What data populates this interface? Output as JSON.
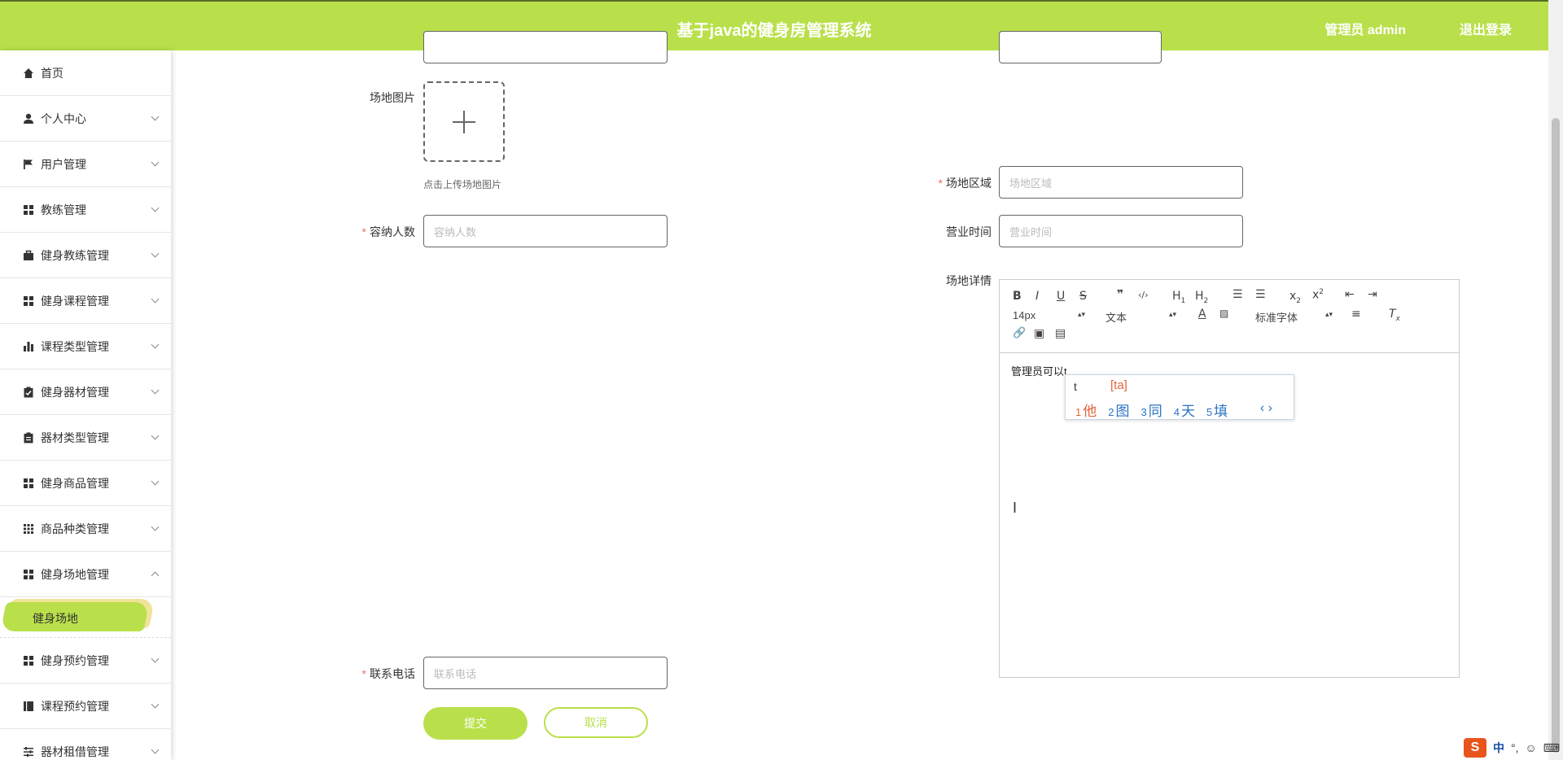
{
  "header": {
    "title": "基于java的健身房管理系统",
    "admin_label": "管理员 admin",
    "logout_label": "退出登录"
  },
  "sidebar": {
    "items": [
      {
        "label": "首页",
        "icon": "home-icon",
        "expandable": false
      },
      {
        "label": "个人中心",
        "icon": "user-icon",
        "expandable": true
      },
      {
        "label": "用户管理",
        "icon": "flag-icon",
        "expandable": true
      },
      {
        "label": "教练管理",
        "icon": "grid-icon",
        "expandable": true
      },
      {
        "label": "健身教练管理",
        "icon": "briefcase-icon",
        "expandable": true
      },
      {
        "label": "健身课程管理",
        "icon": "grid-icon",
        "expandable": true
      },
      {
        "label": "课程类型管理",
        "icon": "bar-chart-icon",
        "expandable": true
      },
      {
        "label": "健身器材管理",
        "icon": "clipboard-check-icon",
        "expandable": true
      },
      {
        "label": "器材类型管理",
        "icon": "clipboard-icon",
        "expandable": true
      },
      {
        "label": "健身商品管理",
        "icon": "grid-icon",
        "expandable": true
      },
      {
        "label": "商品种类管理",
        "icon": "grid-3x3-icon",
        "expandable": true
      },
      {
        "label": "健身场地管理",
        "icon": "grid-icon",
        "expandable": true,
        "expanded": true
      },
      {
        "label": "健身预约管理",
        "icon": "grid-icon",
        "expandable": true
      },
      {
        "label": "课程预约管理",
        "icon": "book-icon",
        "expandable": true
      },
      {
        "label": "器材租借管理",
        "icon": "sliders-icon",
        "expandable": true
      }
    ],
    "active_sub": "健身场地"
  },
  "form": {
    "image_label": "场地图片",
    "upload_tip": "点击上传场地图片",
    "area_label": "场地区域",
    "area_placeholder": "场地区域",
    "capacity_label": "容纳人数",
    "capacity_placeholder": "容纳人数",
    "hours_label": "营业时间",
    "hours_placeholder": "营业时间",
    "detail_label": "场地详情",
    "phone_label": "联系电话",
    "phone_placeholder": "联系电话",
    "submit_label": "提交",
    "cancel_label": "取消"
  },
  "editor": {
    "font_size": "14px",
    "block_type": "文本",
    "font_family": "标准字体",
    "content": "管理员可以t"
  },
  "ime": {
    "typed": "t",
    "pinyin": "[ta]",
    "candidates": [
      {
        "num": "1",
        "char": "他"
      },
      {
        "num": "2",
        "char": "图"
      },
      {
        "num": "3",
        "char": "同"
      },
      {
        "num": "4",
        "char": "天"
      },
      {
        "num": "5",
        "char": "填"
      }
    ]
  },
  "tray": {
    "lang": "中"
  },
  "colors": {
    "accent": "#b9e04a",
    "required": "#f56c6c"
  }
}
